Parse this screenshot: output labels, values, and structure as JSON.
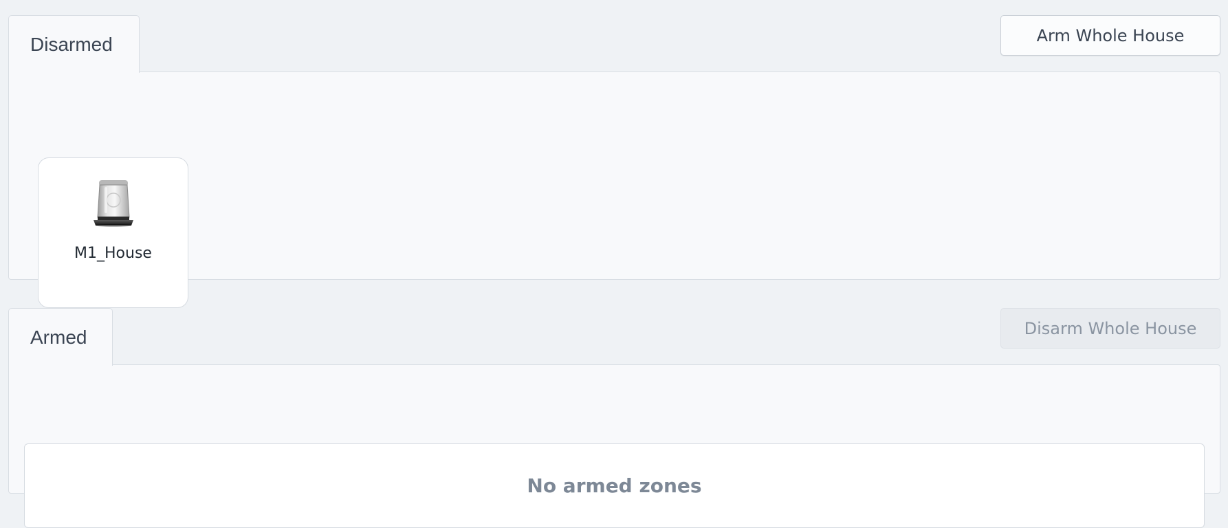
{
  "disarmed_section": {
    "tab_label": "Disarmed",
    "action_button_label": "Arm Whole House",
    "zones": [
      {
        "name": "M1_House",
        "icon": "alarm-beacon-icon"
      }
    ]
  },
  "armed_section": {
    "tab_label": "Armed",
    "action_button_label": "Disarm Whole House",
    "action_button_disabled": true,
    "empty_message": "No armed zones"
  },
  "colors": {
    "page_background": "#eff2f5",
    "panel_background": "#f8f9fb",
    "text_primary": "#3a4452",
    "text_muted": "#7d8896"
  }
}
